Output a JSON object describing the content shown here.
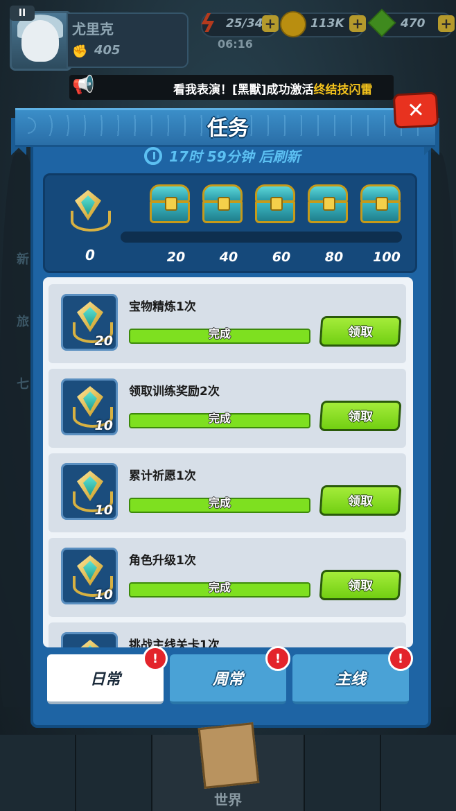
{
  "hud": {
    "pause_label": "II",
    "player_name": "尤里克",
    "power": "405",
    "energy": "25/34",
    "gold": "113K",
    "gems": "470",
    "timer": "06:16"
  },
  "marquee": {
    "prefix": "看我表演！[黑獸]成功激活",
    "highlight": "终结技闪雷"
  },
  "dialog": {
    "title": "任务",
    "close_label": "✕",
    "refresh_text": "17时 59分钟 后刷新"
  },
  "progress": {
    "current_points": "0",
    "fill_fraction": 0,
    "milestones": [
      "20",
      "40",
      "60",
      "80",
      "100"
    ]
  },
  "tasks": [
    {
      "name": "宝物精炼1次",
      "reward": "20",
      "status": "完成",
      "button": "领取"
    },
    {
      "name": "领取训练奖励2次",
      "reward": "10",
      "status": "完成",
      "button": "领取"
    },
    {
      "name": "累计祈愿1次",
      "reward": "10",
      "status": "完成",
      "button": "领取"
    },
    {
      "name": "角色升级1次",
      "reward": "10",
      "status": "完成",
      "button": "领取"
    },
    {
      "name": "挑战主线关卡1次",
      "reward": "",
      "status": "",
      "button": ""
    }
  ],
  "tabs": [
    {
      "label": "日常",
      "active": true,
      "badge": "!"
    },
    {
      "label": "周常",
      "active": false,
      "badge": "!"
    },
    {
      "label": "主线",
      "active": false,
      "badge": "!"
    }
  ],
  "bottom_nav": {
    "world_label": "世界"
  },
  "side_hints": [
    "新",
    "旅",
    "七"
  ],
  "colors": {
    "dialog_blue": "#1e64a4",
    "claim_green": "#7ee020",
    "close_red": "#e8321f",
    "highlight_yellow": "#f3c21c"
  }
}
